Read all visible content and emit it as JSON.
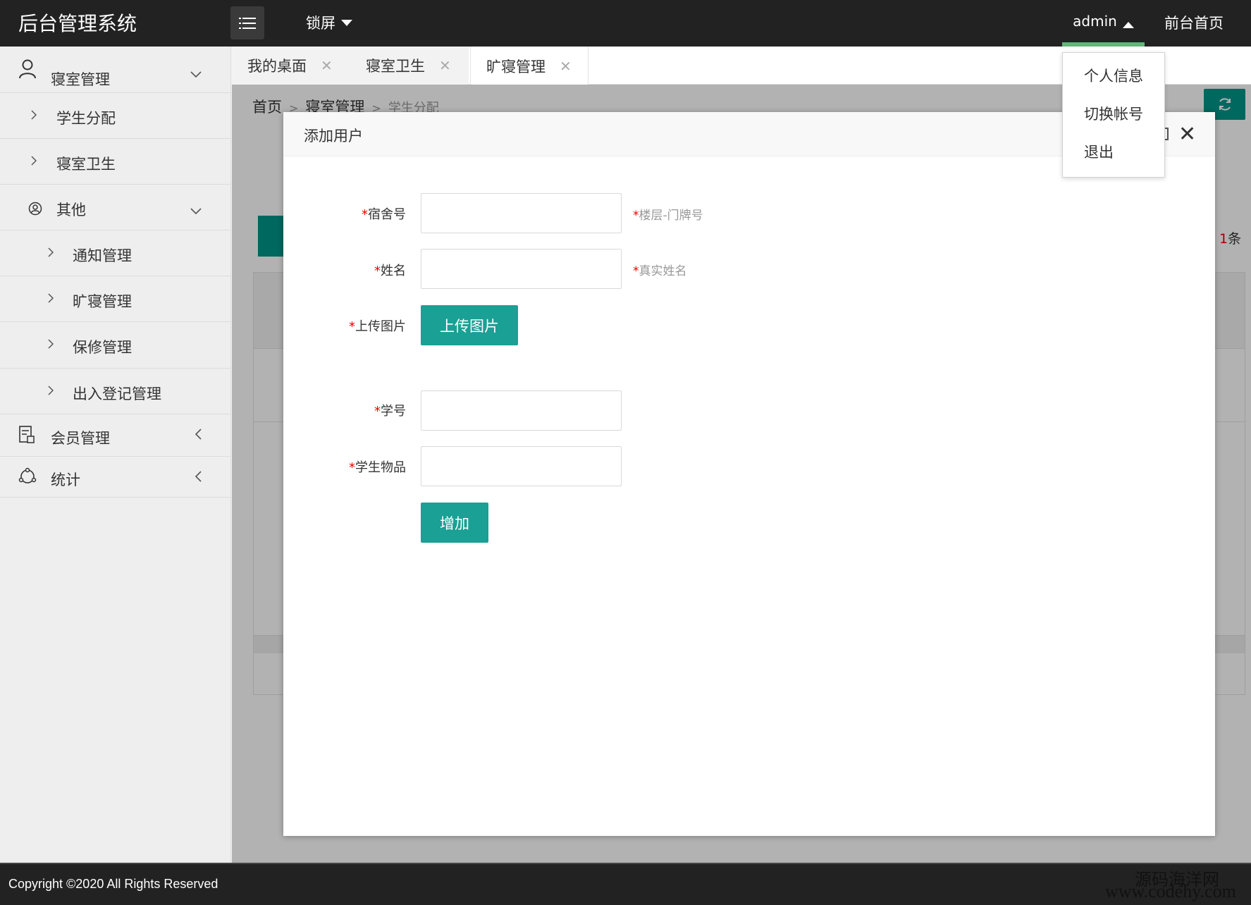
{
  "app": {
    "title": "后台管理系统",
    "lock_label": "锁屏",
    "user": "admin",
    "front_label": "前台首页"
  },
  "user_menu": [
    "个人信息",
    "切换帐号",
    "退出"
  ],
  "sidebar": {
    "items": [
      {
        "label": "寝室管理",
        "icon": "user-icon",
        "arrow": "down"
      },
      {
        "label": "学生分配",
        "sub": true
      },
      {
        "label": "寝室卫生",
        "sub": true
      },
      {
        "label": "其他",
        "icon": "face-icon",
        "arrow": "down"
      },
      {
        "label": "通知管理",
        "sub": true
      },
      {
        "label": "旷寝管理",
        "sub": true
      },
      {
        "label": "保修管理",
        "sub": true
      },
      {
        "label": "出入登记管理",
        "sub": true
      },
      {
        "label": "会员管理",
        "icon": "member-icon",
        "arrow": "left"
      },
      {
        "label": "统计",
        "icon": "stats-icon",
        "arrow": "left"
      }
    ]
  },
  "tabs": [
    {
      "label": "我的桌面"
    },
    {
      "label": "寝室卫生"
    },
    {
      "label": "旷寝管理",
      "active": true
    }
  ],
  "breadcrumb": {
    "home": "首页",
    "section": "寝室管理",
    "current": "学生分配",
    "sep": ">"
  },
  "background": {
    "count_num": "1",
    "count_unit": "条"
  },
  "modal": {
    "title": "添加用户",
    "fields": {
      "dorm": {
        "label": "宿舍号",
        "hint": "楼层-门牌号",
        "value": ""
      },
      "name": {
        "label": "姓名",
        "hint": "真实姓名",
        "value": ""
      },
      "upload": {
        "label": "上传图片",
        "button": "上传图片"
      },
      "student_id": {
        "label": "学号",
        "value": ""
      },
      "items": {
        "label": "学生物品",
        "value": ""
      }
    },
    "submit": "增加",
    "required_mark": "*"
  },
  "footer": {
    "copyright": "Copyright ©2020 All Rights Reserved"
  },
  "watermark": {
    "line1": "源码海洋网",
    "line2": "www.codehy.com"
  },
  "colors": {
    "header_bg": "#222222",
    "accent": "#009688",
    "button": "#1aa094",
    "active_underline": "#5fb878",
    "required": "#ee0000"
  }
}
